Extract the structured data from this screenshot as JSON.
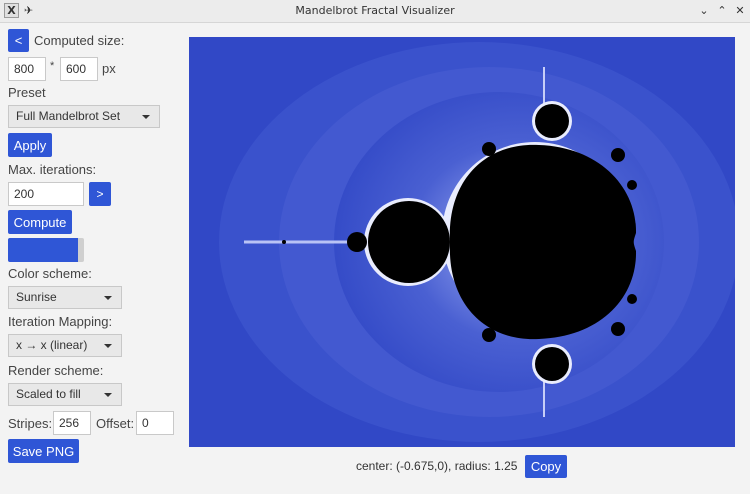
{
  "window": {
    "title": "Mandelbrot Fractal Visualizer",
    "app_icon_glyph": "X",
    "pin_glyph": "✈",
    "minimize_glyph": "⌄",
    "maximize_glyph": "⌃",
    "close_glyph": "✕"
  },
  "sidebar": {
    "collapse_label": "<",
    "computed_size_label": "Computed size:",
    "width_value": "800",
    "times_sign": "*",
    "height_value": "600",
    "size_unit": "px",
    "preset_label": "Preset",
    "preset_selected": "Full Mandelbrot Set",
    "apply_label": "Apply",
    "max_iterations_label": "Max. iterations:",
    "max_iterations_value": "200",
    "iterations_next_label": ">",
    "compute_label": "Compute",
    "progress": 0.92,
    "color_scheme_label": "Color scheme:",
    "color_scheme_selected": "Sunrise",
    "iteration_mapping_label": "Iteration Mapping:",
    "iteration_mapping_selected": "x → x (linear)",
    "render_scheme_label": "Render scheme:",
    "render_scheme_selected": "Scaled to fill",
    "stripes_label": "Stripes:",
    "stripes_value": "256",
    "offset_label": "Offset:",
    "offset_value": "0",
    "save_label": "Save PNG"
  },
  "viewer": {
    "status_text": "center: (-0.675,0), radius: 1.25",
    "copy_label": "Copy"
  },
  "colors": {
    "accent": "#2f56d6",
    "fractal_background": "#3148c6",
    "fractal_set": "#000000"
  }
}
